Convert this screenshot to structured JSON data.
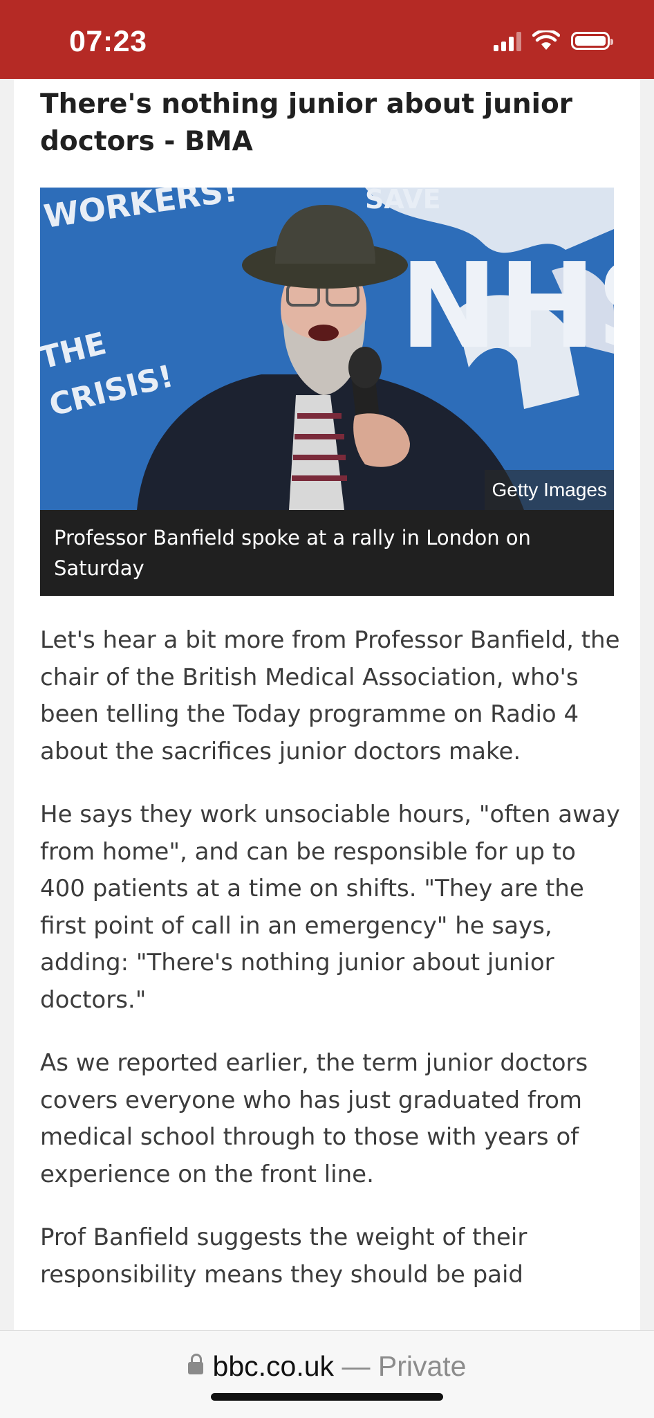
{
  "status_bar": {
    "time": "07:23",
    "icons": [
      "cellular-signal-icon",
      "wifi-icon",
      "battery-icon"
    ],
    "background_color": "#b52a25"
  },
  "article": {
    "headline": "There's nothing junior about junior doctors - BMA",
    "image": {
      "credit": "Getty Images",
      "caption": "Professor Banfield spoke at a rally in London on Saturday",
      "background_text": [
        "WORKERS!",
        "THE",
        "CRISIS!",
        "SAVE",
        "NHS"
      ]
    },
    "paragraphs": [
      "Let's hear a bit more from Professor Banfield, the chair of the British Medical Association, who's been telling the Today programme on Radio 4 about the sacrifices junior doctors make.",
      "He says they work unsociable hours, \"often away from home\", and can be responsible for up to 400 patients at a time on shifts. \"They are the first point of call in an emergency\" he says, adding: \"There's nothing junior about junior doctors.\"",
      "As we reported earlier, the term junior doctors covers everyone who has just graduated from medical school through to those with years of experience on the front line.",
      "Prof Banfield suggests the weight of their responsibility means they should be paid"
    ]
  },
  "browser": {
    "domain": "bbc.co.uk",
    "separator": "—",
    "mode": "Private",
    "lock_icon": "lock-icon"
  }
}
